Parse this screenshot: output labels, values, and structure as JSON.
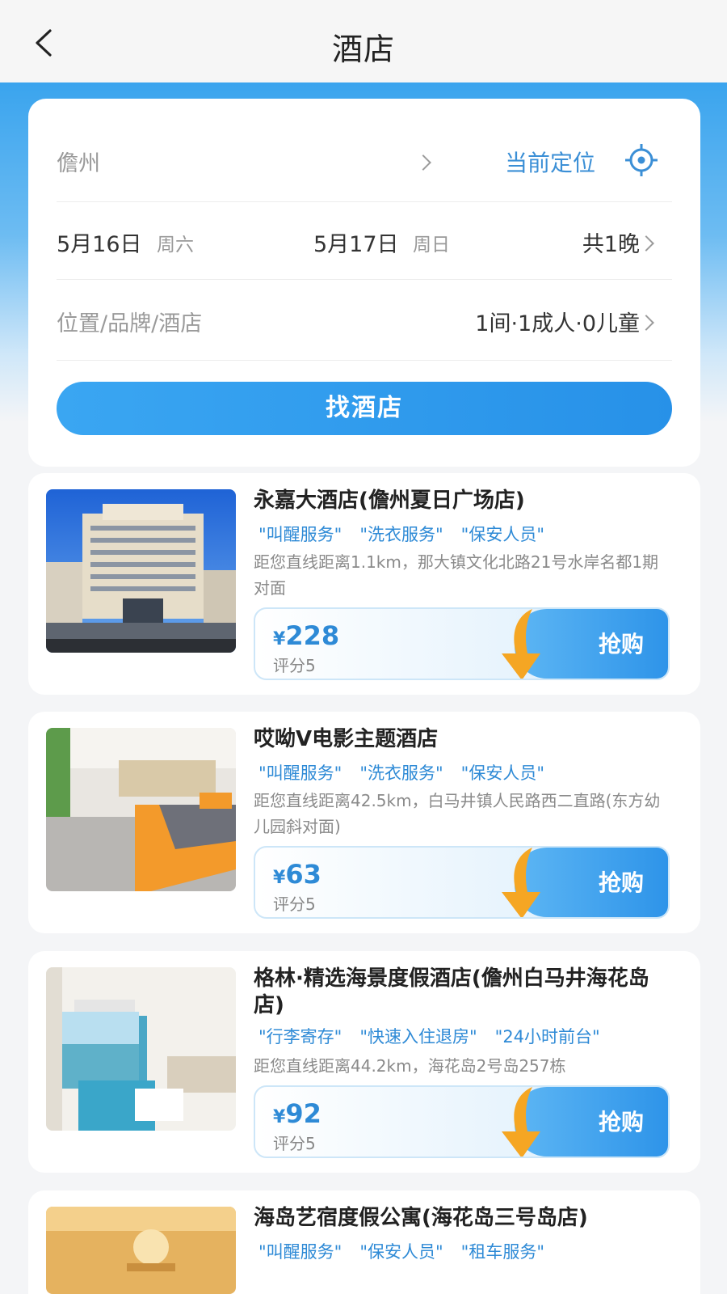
{
  "header": {
    "title": "酒店"
  },
  "search": {
    "city": "儋州",
    "current_location": "当前定位",
    "check_in_date": "5月16日",
    "check_in_day": "周六",
    "check_out_date": "5月17日",
    "check_out_day": "周日",
    "nights": "共1晚",
    "keyword_placeholder": "位置/品牌/酒店",
    "guests": "1间·1成人·0儿童",
    "button": "找酒店"
  },
  "hotels": [
    {
      "name": "永嘉大酒店(儋州夏日广场店)",
      "tags": [
        "\"叫醒服务\"",
        "\"洗衣服务\"",
        "\"保安人员\""
      ],
      "address": "距您直线距离1.1km，那大镇文化北路21号水岸名都1期对面",
      "currency": "¥",
      "price": "228",
      "score": "评分5",
      "action": "抢购"
    },
    {
      "name": "哎呦V电影主题酒店",
      "tags": [
        "\"叫醒服务\"",
        "\"洗衣服务\"",
        "\"保安人员\""
      ],
      "address": "距您直线距离42.5km，白马井镇人民路西二直路(东方幼儿园斜对面)",
      "currency": "¥",
      "price": "63",
      "score": "评分5",
      "action": "抢购"
    },
    {
      "name": "格林·精选海景度假酒店(儋州白马井海花岛店)",
      "tags": [
        "\"行李寄存\"",
        "\"快速入住退房\"",
        "\"24小时前台\""
      ],
      "address": "距您直线距离44.2km，海花岛2号岛257栋",
      "currency": "¥",
      "price": "92",
      "score": "评分5",
      "action": "抢购"
    },
    {
      "name": "海岛艺宿度假公寓(海花岛三号岛店)",
      "tags": [
        "\"叫醒服务\"",
        "\"保安人员\"",
        "\"租车服务\""
      ]
    }
  ],
  "colors": {
    "accent": "#2e8ad6",
    "band": "#3aa4ee",
    "arrow": "#f5a623"
  }
}
